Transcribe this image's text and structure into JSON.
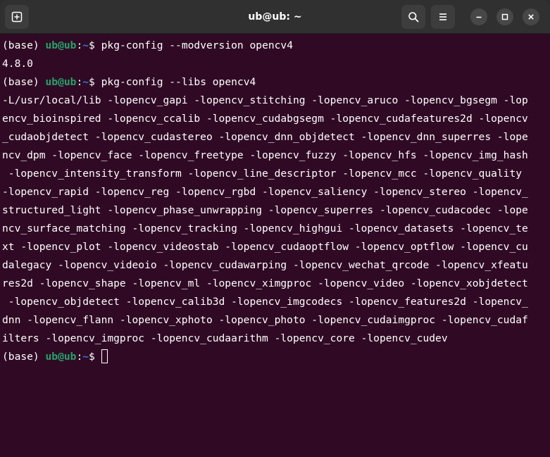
{
  "window": {
    "title": "ub@ub: ~"
  },
  "prompt": {
    "env": "(base) ",
    "user_host": "ub@ub",
    "colon": ":",
    "path": "~",
    "dollar": "$ "
  },
  "commands": [
    "pkg-config --modversion opencv4",
    "pkg-config --libs opencv4"
  ],
  "outputs": {
    "version": "4.8.0",
    "libs_lines": [
      "-L/usr/local/lib -lopencv_gapi -lopencv_stitching -lopencv_aruco -lopencv_bgsegm -lop",
      "encv_bioinspired -lopencv_ccalib -lopencv_cudabgsegm -lopencv_cudafeatures2d -lopencv",
      "_cudaobjdetect -lopencv_cudastereo -lopencv_dnn_objdetect -lopencv_dnn_superres -lope",
      "ncv_dpm -lopencv_face -lopencv_freetype -lopencv_fuzzy -lopencv_hfs -lopencv_img_hash",
      " -lopencv_intensity_transform -lopencv_line_descriptor -lopencv_mcc -lopencv_quality ",
      "-lopencv_rapid -lopencv_reg -lopencv_rgbd -lopencv_saliency -lopencv_stereo -lopencv_",
      "structured_light -lopencv_phase_unwrapping -lopencv_superres -lopencv_cudacodec -lope",
      "ncv_surface_matching -lopencv_tracking -lopencv_highgui -lopencv_datasets -lopencv_te",
      "xt -lopencv_plot -lopencv_videostab -lopencv_cudaoptflow -lopencv_optflow -lopencv_cu",
      "dalegacy -lopencv_videoio -lopencv_cudawarping -lopencv_wechat_qrcode -lopencv_xfeatu",
      "res2d -lopencv_shape -lopencv_ml -lopencv_ximgproc -lopencv_video -lopencv_xobjdetect",
      " -lopencv_objdetect -lopencv_calib3d -lopencv_imgcodecs -lopencv_features2d -lopencv_",
      "dnn -lopencv_flann -lopencv_xphoto -lopencv_photo -lopencv_cudaimgproc -lopencv_cudaf",
      "ilters -lopencv_imgproc -lopencv_cudaarithm -lopencv_core -lopencv_cudev"
    ]
  },
  "icons": {
    "new_tab": "new-tab-icon",
    "search": "search-icon",
    "menu": "hamburger-menu-icon",
    "minimize": "minimize-icon",
    "maximize": "maximize-icon",
    "close": "close-icon"
  },
  "colors": {
    "terminal_bg": "#300a24",
    "titlebar_bg": "#303030",
    "prompt_user": "#26a269",
    "prompt_path": "#2a7bde",
    "text": "#ffffff"
  }
}
